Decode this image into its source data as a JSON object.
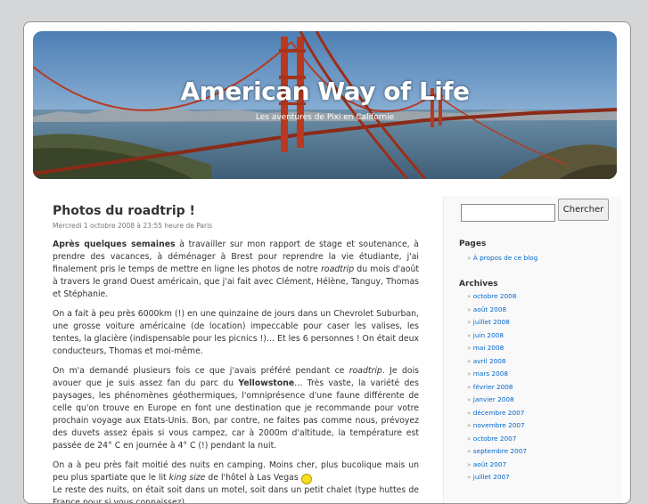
{
  "header": {
    "title": "American Way of Life",
    "description": "Les aventures de Pixi en Californie"
  },
  "post": {
    "title": "Photos du roadtrip !",
    "date": "Mercredi 1 octobre 2008 à 23:55 heure de Paris",
    "p1_bold": "Après quelques semaines",
    "p1_a": " à travailler sur mon rapport de stage et soutenance, à prendre des vacances, à déménager à Brest pour reprendre la vie étudiante, j'ai finalement pris le temps de mettre en ligne les photos de notre ",
    "p1_em": "roadtrip",
    "p1_b": " du mois d'août à travers le grand Ouest américain, que j'ai fait avec Clément, Hélène, Tanguy, Thomas et Stéphanie.",
    "p2": "On a fait à peu près 6000km (!) en une quinzaine de jours dans un Chevrolet Suburban, une grosse voiture américaine (de location) impeccable pour caser les valises, les tentes, la glacière (indispensable pour les picnics !)… Et les 6 personnes ! On était deux conducteurs, Thomas et moi-même.",
    "p3_a": "On m'a demandé plusieurs fois ce que j'avais préféré pendant ce ",
    "p3_em": "roadtrip",
    "p3_b": ". Je dois avouer que je suis assez fan du parc du ",
    "p3_bold": "Yellowstone",
    "p3_c": "… Très vaste, la variété des paysages, les phénomènes géothermiques, l'omniprésence d'une faune différente de celle qu'on trouve en Europe en font une destination que je recommande pour votre prochain voyage aux Etats-Unis. Bon, par contre, ne faites pas comme nous, prévoyez des duvets assez épais si vous campez, car à 2000m d'altitude, la température est passée de 24° C en journée à 4° C (!) pendant la nuit.",
    "p4_a": "On a à peu près fait moitié des nuits en camping. Moins cher, plus bucolique mais un peu plus spartiate que le lit ",
    "p4_em": "king size",
    "p4_b": " de l'hôtel à Las Vegas ",
    "p5": "Le reste des nuits, on était soit dans un motel, soit dans un petit chalet (type huttes de France pour si vous connaissez)."
  },
  "sidebar": {
    "search_button": "Chercher",
    "search_value": "",
    "pages_heading": "Pages",
    "pages": [
      "À propos de ce blog"
    ],
    "archives_heading": "Archives",
    "archives": [
      "octobre 2008",
      "août 2008",
      "juillet 2008",
      "juin 2008",
      "mai 2008",
      "avril 2008",
      "mars 2008",
      "février 2008",
      "janvier 2008",
      "décembre 2007",
      "novembre 2007",
      "octobre 2007",
      "septembre 2007",
      "août 2007",
      "juillet 2007"
    ]
  },
  "colors": {
    "link": "#0066cc",
    "background": "#d5d6d7"
  },
  "icons": {
    "smiley": "smiley-icon",
    "bullet": "»"
  }
}
